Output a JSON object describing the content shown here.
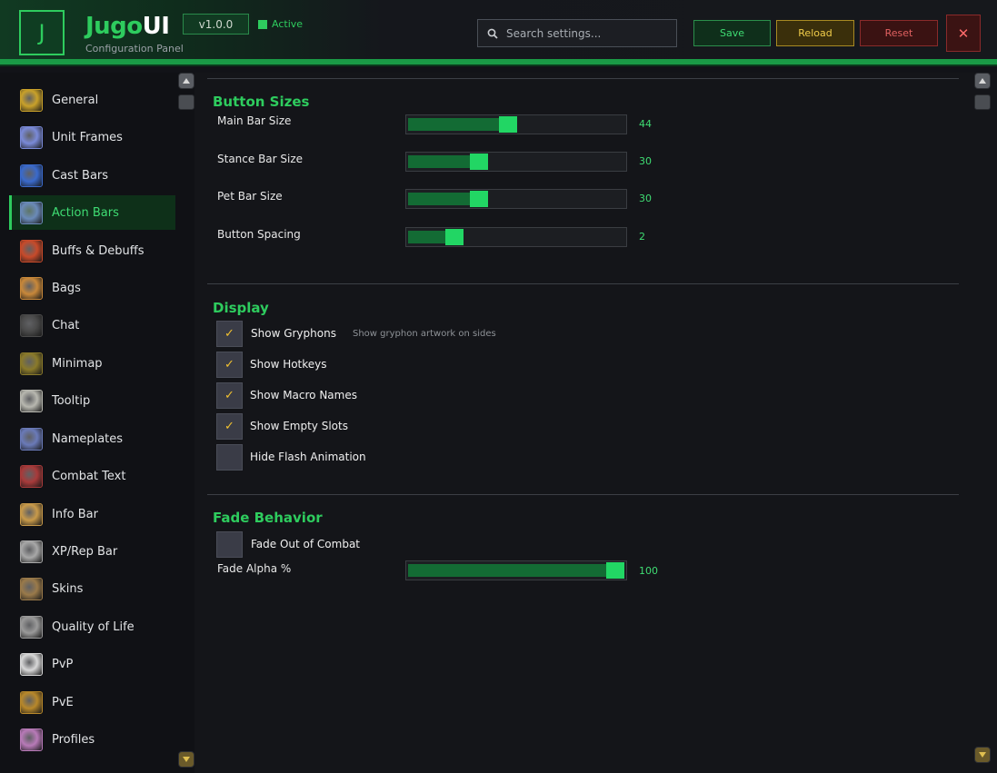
{
  "header": {
    "logo_letter": "J",
    "title_part1": "Jugo",
    "title_part2": "UI",
    "subtitle": "Configuration Panel",
    "version": "v1.0.0",
    "status": "Active",
    "search_placeholder": "Search settings...",
    "save_label": "Save",
    "reload_label": "Reload",
    "reset_label": "Reset",
    "close_label": "✕"
  },
  "sidebar": {
    "active": "Action Bars",
    "items": [
      {
        "label": "General",
        "icon": "gear-gold-icon",
        "color": "#c9a12a"
      },
      {
        "label": "Unit Frames",
        "icon": "spark-icon",
        "color": "#7a8ad8"
      },
      {
        "label": "Cast Bars",
        "icon": "bolt-icon",
        "color": "#3a6acc"
      },
      {
        "label": "Action Bars",
        "icon": "sword-icon",
        "color": "#6a8ab8"
      },
      {
        "label": "Buffs & Debuffs",
        "icon": "shield-buff-icon",
        "color": "#c84a2a"
      },
      {
        "label": "Bags",
        "icon": "bag-icon",
        "color": "#c8883a"
      },
      {
        "label": "Chat",
        "icon": "chat-icon",
        "color": "#4a4a4a"
      },
      {
        "label": "Minimap",
        "icon": "map-icon",
        "color": "#8a7a2a"
      },
      {
        "label": "Tooltip",
        "icon": "scroll-icon",
        "color": "#b8b8b0"
      },
      {
        "label": "Nameplates",
        "icon": "dagger-icon",
        "color": "#6a7ab8"
      },
      {
        "label": "Combat Text",
        "icon": "combat-text-icon",
        "color": "#a83a3a"
      },
      {
        "label": "Info Bar",
        "icon": "info-bar-icon",
        "color": "#c89a4a"
      },
      {
        "label": "XP/Rep Bar",
        "icon": "xp-wings-icon",
        "color": "#a8a8a8"
      },
      {
        "label": "Skins",
        "icon": "crate-icon",
        "color": "#9a7a4a"
      },
      {
        "label": "Quality of Life",
        "icon": "cog-silver-icon",
        "color": "#9a9a9a"
      },
      {
        "label": "PvP",
        "icon": "crossed-swords-icon",
        "color": "#d8d8d8"
      },
      {
        "label": "PvE",
        "icon": "armor-icon",
        "color": "#b8882a"
      },
      {
        "label": "Profiles",
        "icon": "profile-icon",
        "color": "#b87ab8"
      }
    ]
  },
  "main": {
    "sections": {
      "button_sizes": {
        "title": "Button Sizes",
        "sliders": [
          {
            "label": "Main Bar Size",
            "value": "44",
            "fraction": 0.46
          },
          {
            "label": "Stance Bar Size",
            "value": "30",
            "fraction": 0.31
          },
          {
            "label": "Pet Bar Size",
            "value": "30",
            "fraction": 0.31
          },
          {
            "label": "Button Spacing",
            "value": "2",
            "fraction": 0.19
          }
        ]
      },
      "display": {
        "title": "Display",
        "checkboxes": [
          {
            "label": "Show Gryphons",
            "checked": true,
            "desc": "Show gryphon artwork on sides"
          },
          {
            "label": "Show Hotkeys",
            "checked": true,
            "desc": ""
          },
          {
            "label": "Show Macro Names",
            "checked": true,
            "desc": ""
          },
          {
            "label": "Show Empty Slots",
            "checked": true,
            "desc": ""
          },
          {
            "label": "Hide Flash Animation",
            "checked": false,
            "desc": ""
          }
        ]
      },
      "fade_behavior": {
        "title": "Fade Behavior",
        "checkbox": {
          "label": "Fade Out of Combat",
          "checked": false
        },
        "slider": {
          "label": "Fade Alpha %",
          "value": "100",
          "fraction": 1.0
        }
      }
    }
  },
  "colors": {
    "accent": "#2ecc5e",
    "reload": "#f0cc4a",
    "reset": "#e06060",
    "checkmark": "#f0c030"
  }
}
